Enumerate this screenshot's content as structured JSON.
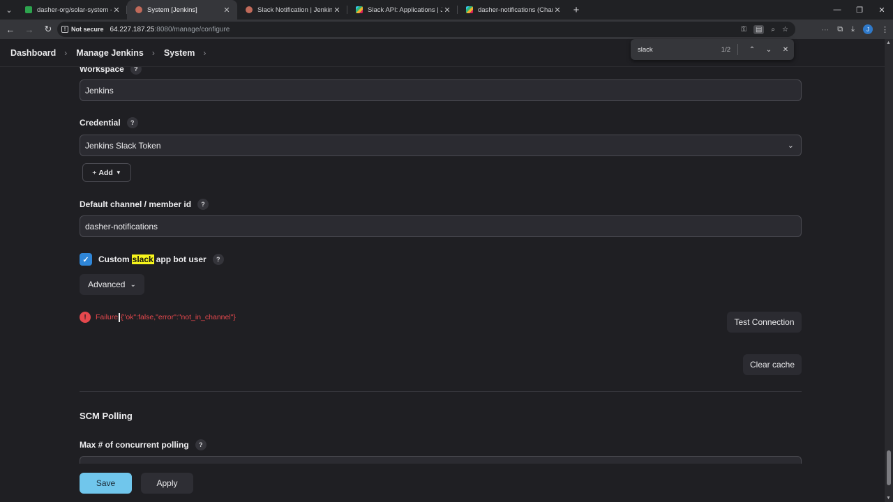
{
  "browser": {
    "tabs": [
      {
        "title": "dasher-org/solar-system - sola",
        "color": "#2da44e",
        "active": false
      },
      {
        "title": "System [Jenkins]",
        "color": "#c06a5a",
        "active": true
      },
      {
        "title": "Slack Notification | Jenkins plug",
        "color": "#c06a5a",
        "active": false
      },
      {
        "title": "Slack API: Applications | Jenkins",
        "color": "#e01e5a",
        "active": false
      },
      {
        "title": "dasher-notifications (Channel)",
        "color": "#e01e5a",
        "active": false
      }
    ],
    "security": "Not secure",
    "url_host": "64.227.187.25",
    "url_path": ":8080/manage/configure",
    "profile_initial": "J"
  },
  "find": {
    "query": "slack",
    "count": "1/2"
  },
  "breadcrumb": [
    "Dashboard",
    "Manage Jenkins",
    "System"
  ],
  "form": {
    "workspace_label": "Workspace",
    "workspace_value": "Jenkins",
    "credential_label": "Credential",
    "credential_value": "Jenkins Slack Token",
    "add_label": "Add",
    "channel_label": "Default channel / member id",
    "channel_value": "dasher-notifications",
    "custom_bot_prefix": "Custom",
    "custom_bot_highlight": "slack",
    "custom_bot_suffix": "app bot user",
    "advanced_label": "Advanced",
    "failure_text": "Failure",
    "failure_detail": "{\"ok\":false,\"error\":\"not_in_channel\"}",
    "test_connection_label": "Test Connection",
    "clear_cache_label": "Clear cache",
    "scm_section": "SCM Polling",
    "max_polling_label": "Max # of concurrent polling"
  },
  "actions": {
    "save": "Save",
    "apply": "Apply"
  },
  "colors": {
    "accent": "#70c6ec",
    "error": "#e5484d",
    "checkbox": "#2f86d8",
    "highlight": "#f7f51c"
  }
}
